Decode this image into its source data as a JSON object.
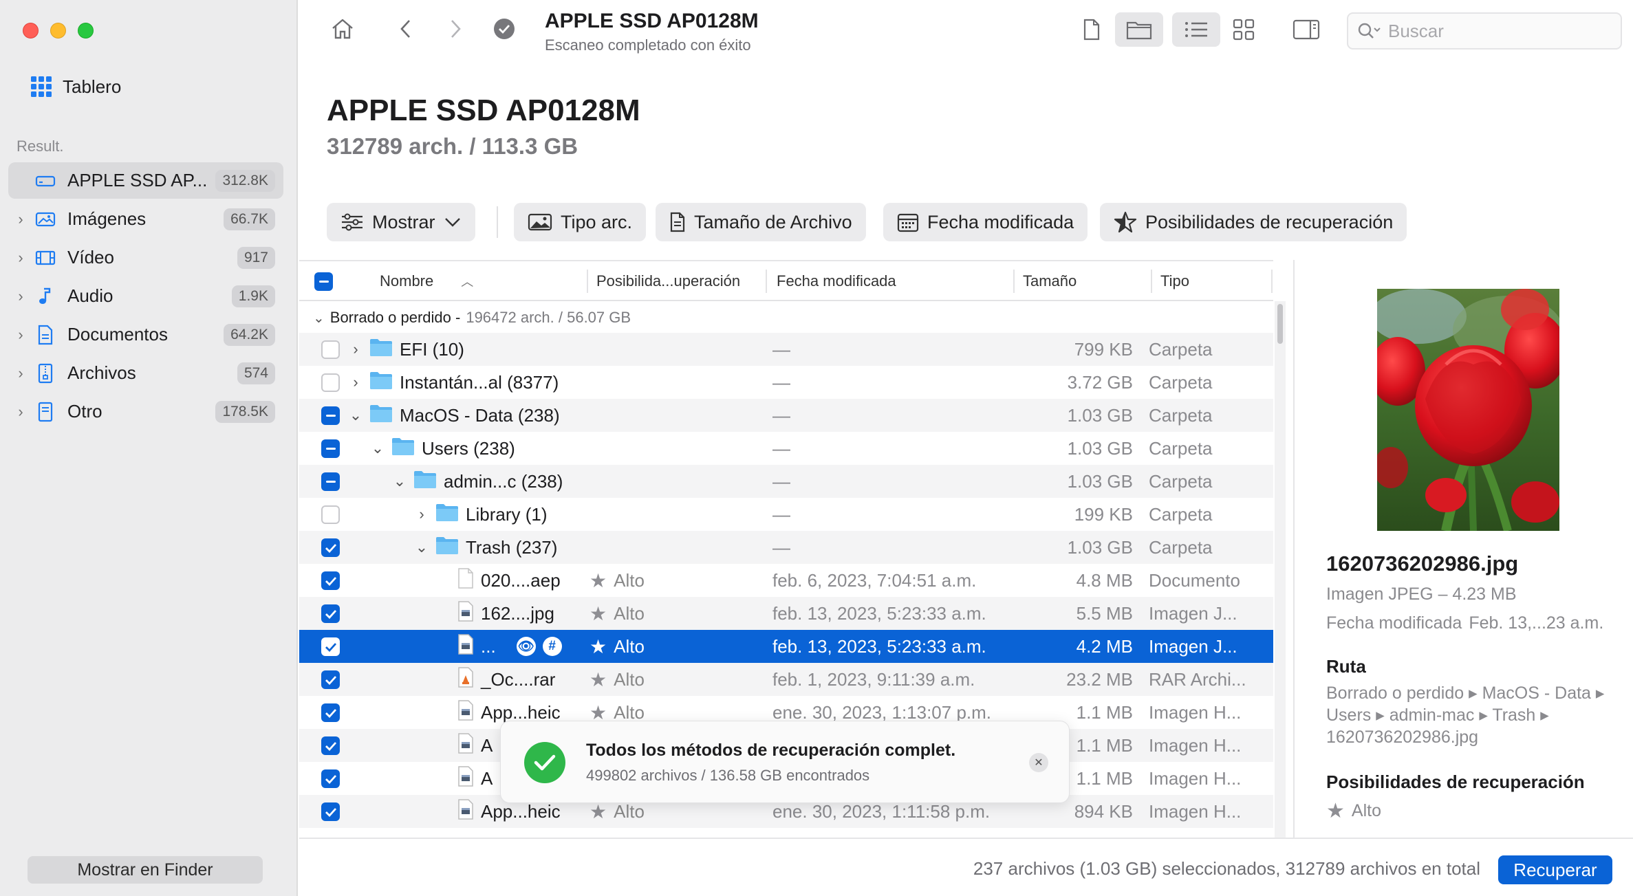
{
  "sidebar": {
    "dashboard_label": "Tablero",
    "section_label": "Result.",
    "items": [
      {
        "label": "APPLE SSD AP...",
        "count": "312.8K",
        "icon": "drive-icon"
      },
      {
        "label": "Imágenes",
        "count": "66.7K",
        "icon": "image-icon"
      },
      {
        "label": "Vídeo",
        "count": "917",
        "icon": "film-icon"
      },
      {
        "label": "Audio",
        "count": "1.9K",
        "icon": "music-note-icon"
      },
      {
        "label": "Documentos",
        "count": "64.2K",
        "icon": "document-icon"
      },
      {
        "label": "Archivos",
        "count": "574",
        "icon": "archive-icon"
      },
      {
        "label": "Otro",
        "count": "178.5K",
        "icon": "other-file-icon"
      }
    ],
    "finder_button": "Mostrar en Finder"
  },
  "toolbar": {
    "title": "APPLE SSD AP0128M",
    "subtitle": "Escaneo completado con éxito",
    "search_placeholder": "Buscar"
  },
  "header": {
    "title": "APPLE SSD AP0128M",
    "subtitle": "312789 arch. / 113.3 GB"
  },
  "filters": {
    "show": "Mostrar",
    "file_type": "Tipo arc.",
    "file_size": "Tamaño de Archivo",
    "date_modified": "Fecha modificada",
    "recovery_chances": "Posibilidades de recuperación"
  },
  "table": {
    "columns": {
      "name": "Nombre",
      "chances": "Posibilida...uperación",
      "date": "Fecha modificada",
      "size": "Tamaño",
      "type": "Tipo"
    },
    "group": {
      "name": "Borrado o perdido -",
      "info": "196472 arch. / 56.07 GB"
    },
    "rows": [
      {
        "check": "off",
        "level": 0,
        "disclosure": "›",
        "kind": "folder",
        "name": "EFI (10)",
        "chance": "",
        "date": "—",
        "size": "799 KB",
        "type": "Carpeta"
      },
      {
        "check": "off",
        "level": 0,
        "disclosure": "›",
        "kind": "folder",
        "name": "Instantán...al (8377)",
        "chance": "",
        "date": "—",
        "size": "3.72 GB",
        "type": "Carpeta"
      },
      {
        "check": "mixed",
        "level": 0,
        "disclosure": "⌄",
        "kind": "folder",
        "name": "MacOS - Data (238)",
        "chance": "",
        "date": "—",
        "size": "1.03 GB",
        "type": "Carpeta"
      },
      {
        "check": "mixed",
        "level": 1,
        "disclosure": "⌄",
        "kind": "folder",
        "name": "Users (238)",
        "chance": "",
        "date": "—",
        "size": "1.03 GB",
        "type": "Carpeta"
      },
      {
        "check": "mixed",
        "level": 2,
        "disclosure": "⌄",
        "kind": "folder",
        "name": "admin...c (238)",
        "chance": "",
        "date": "—",
        "size": "1.03 GB",
        "type": "Carpeta"
      },
      {
        "check": "off",
        "level": 3,
        "disclosure": "›",
        "kind": "folder",
        "name": "Library (1)",
        "chance": "",
        "date": "—",
        "size": "199 KB",
        "type": "Carpeta"
      },
      {
        "check": "on",
        "level": 3,
        "disclosure": "⌄",
        "kind": "folder",
        "name": "Trash (237)",
        "chance": "",
        "date": "—",
        "size": "1.03 GB",
        "type": "Carpeta"
      },
      {
        "check": "on",
        "level": 4,
        "disclosure": "",
        "kind": "file",
        "name": "020....aep",
        "chance": "Alto",
        "date": "feb. 6, 2023, 7:04:51 a.m.",
        "size": "4.8 MB",
        "type": "Documento"
      },
      {
        "check": "on",
        "level": 4,
        "disclosure": "",
        "kind": "image",
        "name": "162....jpg",
        "chance": "Alto",
        "date": "feb. 13, 2023, 5:23:33 a.m.",
        "size": "5.5 MB",
        "type": "Imagen J..."
      },
      {
        "check": "on",
        "level": 4,
        "disclosure": "",
        "kind": "image",
        "name": "...",
        "chance": "Alto",
        "date": "feb. 13, 2023, 5:23:33 a.m.",
        "size": "4.2 MB",
        "type": "Imagen J...",
        "selected": true
      },
      {
        "check": "on",
        "level": 4,
        "disclosure": "",
        "kind": "rar",
        "name": "_Oc....rar",
        "chance": "Alto",
        "date": "feb. 1, 2023, 9:11:39 a.m.",
        "size": "23.2 MB",
        "type": "RAR Archi..."
      },
      {
        "check": "on",
        "level": 4,
        "disclosure": "",
        "kind": "image",
        "name": "App...heic",
        "chance": "Alto",
        "date": "ene. 30, 2023, 1:13:07 p.m.",
        "size": "1.1 MB",
        "type": "Imagen H..."
      },
      {
        "check": "on",
        "level": 4,
        "disclosure": "",
        "kind": "image",
        "name": "A",
        "chance": "",
        "date": "",
        "size": "1.1 MB",
        "type": "Imagen H..."
      },
      {
        "check": "on",
        "level": 4,
        "disclosure": "",
        "kind": "image",
        "name": "A",
        "chance": "",
        "date": "",
        "size": "1.1 MB",
        "type": "Imagen H..."
      },
      {
        "check": "on",
        "level": 4,
        "disclosure": "",
        "kind": "image",
        "name": "App...heic",
        "chance": "Alto",
        "date": "ene. 30, 2023, 1:11:58 p.m.",
        "size": "894 KB",
        "type": "Imagen H..."
      }
    ]
  },
  "toast": {
    "title": "Todos los métodos de recuperación complet.",
    "detail": "499802 archivos / 136.58 GB encontrados"
  },
  "preview": {
    "filename": "1620736202986.jpg",
    "kind": "Imagen JPEG – 4.23 MB",
    "date_label": "Fecha modificada",
    "date_value": "Feb. 13,...23 a.m.",
    "path_heading": "Ruta",
    "path": "Borrado o perdido ▸ MacOS - Data ▸ Users ▸ admin-mac ▸ Trash ▸ 1620736202986.jpg",
    "chances_heading": "Posibilidades de recuperación",
    "chances_value": "Alto"
  },
  "footer": {
    "status": "237 archivos (1.03 GB) seleccionados, 312789 archivos en total",
    "recover_button": "Recuperar"
  },
  "colors": {
    "accent": "#0a63d6",
    "success": "#2fb74a",
    "folder": "#5ab4f0"
  }
}
